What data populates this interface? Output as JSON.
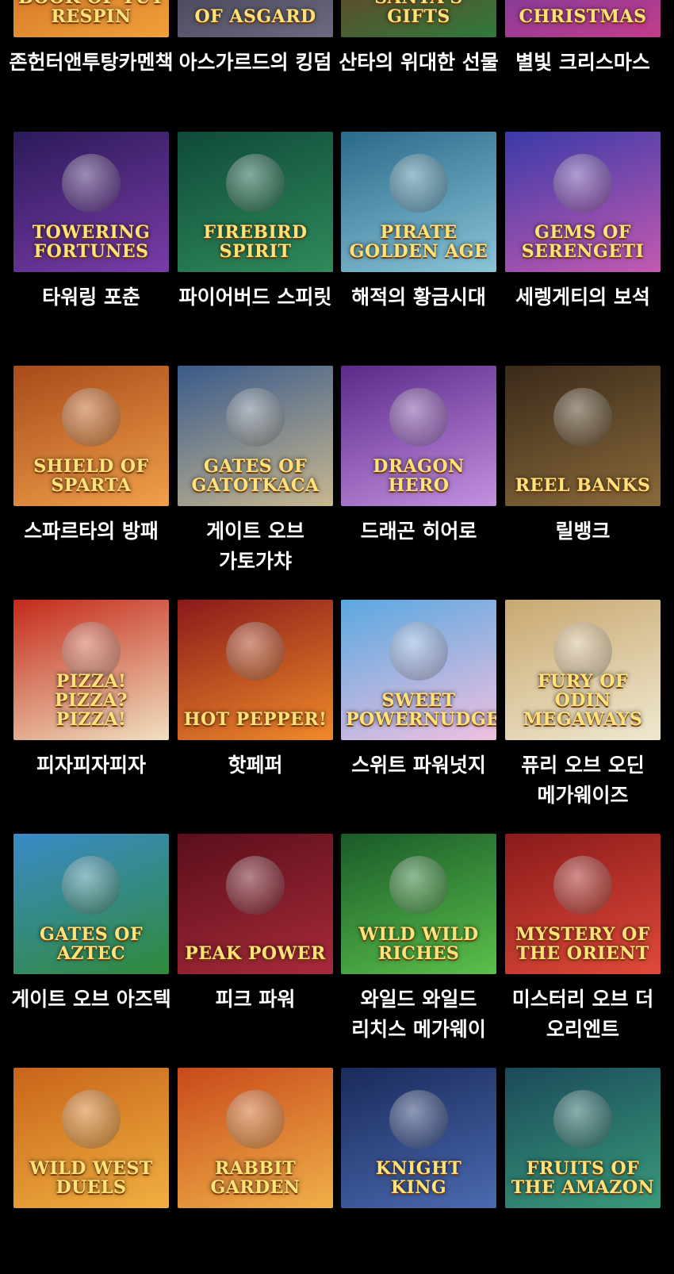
{
  "games": [
    {
      "name": "존헌터앤투탕카멘책",
      "logo": "BOOK OF TUT RESPIN",
      "colors": [
        "#c2571a",
        "#f0a13a"
      ]
    },
    {
      "name": "아스가르드의 킹덤",
      "logo": "OF ASGARD",
      "colors": [
        "#2b2a3a",
        "#6b6a80"
      ]
    },
    {
      "name": "산타의 위대한 선물",
      "logo": "SANTA'S GIFTS",
      "colors": [
        "#8a1f1f",
        "#2f7a3a"
      ]
    },
    {
      "name": "별빛 크리스마스",
      "logo": "Christmas",
      "colors": [
        "#4a3ca8",
        "#c43c8a"
      ]
    },
    {
      "name": "타워링 포춘",
      "logo": "TOWERING FORTUNES",
      "colors": [
        "#2b1a5a",
        "#7a3ca8"
      ]
    },
    {
      "name": "파이어버드 스피릿",
      "logo": "FIREBIRD Spirit",
      "colors": [
        "#0f4a3a",
        "#2f8a5a"
      ]
    },
    {
      "name": "해적의 황금시대",
      "logo": "PIRATE GOLDEN AGE",
      "colors": [
        "#2a6a8a",
        "#8ac4d8"
      ]
    },
    {
      "name": "세렝게티의 보석",
      "logo": "GEMS OF SERENGETI",
      "colors": [
        "#3a3aa8",
        "#c45ab0"
      ]
    },
    {
      "name": "스파르타의 방패",
      "logo": "SHIELD OF SPARTA",
      "colors": [
        "#a84a1a",
        "#f0a04a"
      ]
    },
    {
      "name": "게이트 오브 가토가챠",
      "logo": "Gates of GatotKaca",
      "colors": [
        "#3a5a8a",
        "#c8b890"
      ]
    },
    {
      "name": "드래곤 히어로",
      "logo": "DRAGON HERO",
      "colors": [
        "#5a2a8a",
        "#c490e0"
      ]
    },
    {
      "name": "릴뱅크",
      "logo": "REEL BANKS",
      "colors": [
        "#3a2a1a",
        "#8a6a3a"
      ]
    },
    {
      "name": "피자피자피자",
      "logo": "PIZZA! PIZZA? PIZZA!",
      "colors": [
        "#c42a1a",
        "#f0e0c0"
      ]
    },
    {
      "name": "핫페퍼",
      "logo": "HOT PEPPER!",
      "colors": [
        "#8a1a1a",
        "#f08a2a"
      ]
    },
    {
      "name": "스위트 파워넛지",
      "logo": "Sweet POWERNUDGE",
      "colors": [
        "#5aa8e0",
        "#f0c0e0"
      ]
    },
    {
      "name": "퓨리 오브 오딘 메가웨이즈",
      "logo": "FURY OF ODIN MEGAWAYS",
      "colors": [
        "#c8a870",
        "#f0e8d0"
      ]
    },
    {
      "name": "게이트 오브 아즈텍",
      "logo": "GATES OF AZTEC",
      "colors": [
        "#3a8ac8",
        "#2f8a3a"
      ]
    },
    {
      "name": "피크 파워",
      "logo": "PEAK POWER",
      "colors": [
        "#5a0f1a",
        "#a82a3a"
      ]
    },
    {
      "name": "와일드 와일드 리치스 메가웨이",
      "logo": "WILD WILD RICHES",
      "colors": [
        "#1a5a2a",
        "#5ac04a"
      ]
    },
    {
      "name": "미스터리 오브 더 오리엔트",
      "logo": "MYSTERY OF THE ORIENT",
      "colors": [
        "#8a1a1a",
        "#e04a3a"
      ]
    },
    {
      "name": "",
      "logo": "WILD WEST DUELS",
      "colors": [
        "#c8641a",
        "#f0b040"
      ]
    },
    {
      "name": "",
      "logo": "Rabbit GARDEN",
      "colors": [
        "#c84a1a",
        "#f0b04a"
      ]
    },
    {
      "name": "",
      "logo": "KNIGHT KING",
      "colors": [
        "#1a2a5a",
        "#4a6ab0"
      ]
    },
    {
      "name": "",
      "logo": "FRUITS OF THE AMAZON",
      "colors": [
        "#1a4a5a",
        "#3a9a7a"
      ]
    }
  ]
}
